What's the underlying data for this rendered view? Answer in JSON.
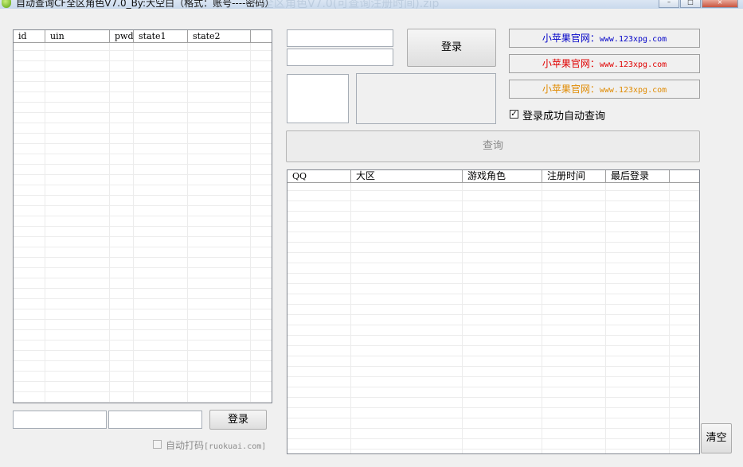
{
  "window": {
    "title": "自动查询CF全区角色V7.0_By:大空白（格式：账号----密码）",
    "ghost": "全区角色V7.0(可查询注册时间).zip"
  },
  "left_grid": {
    "columns": [
      "id",
      "uin",
      "pwd",
      "state1",
      "state2"
    ]
  },
  "left_login": {
    "user_value": "",
    "pass_value": "",
    "button": "登录"
  },
  "auto_captcha": {
    "label": "自动打码",
    "suffix": "[ruokuai.com]",
    "checked": false
  },
  "top_login": {
    "user_value": "",
    "pass_value": "",
    "button": "登录"
  },
  "links": [
    {
      "name": "小苹果官网",
      "sep": "：",
      "url": "www.123xpg.com",
      "color": "#0000c8"
    },
    {
      "name": "小苹果官网",
      "sep": "：",
      "url": "www.123xpg.com",
      "color": "#e00000"
    },
    {
      "name": "小苹果官网",
      "sep": "：",
      "url": "www.123xpg.com",
      "color": "#e08a00"
    }
  ],
  "auto_query": {
    "label": "登录成功自动查询",
    "checked": true,
    "check_glyph": "✓"
  },
  "query_button": "查询",
  "result_grid": {
    "columns": [
      "QQ",
      "大区",
      "游戏角色",
      "注册时间",
      "最后登录"
    ]
  },
  "clear_button": "清空",
  "window_controls": {
    "minimize": "–",
    "maximize": "□",
    "close": "×"
  }
}
